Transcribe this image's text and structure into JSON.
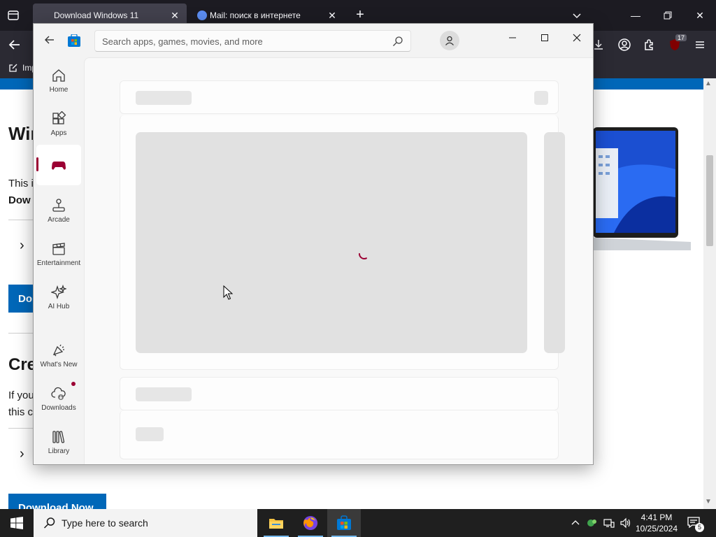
{
  "browser": {
    "tabs": [
      {
        "label": "Download Windows 11",
        "active": true
      },
      {
        "label": "Mail: поиск в интернете",
        "active": false
      }
    ],
    "bookmarks": [
      {
        "label": "Imp"
      }
    ],
    "extension_badge": "17",
    "accent": "#1c1b22"
  },
  "webpage": {
    "title": "Win",
    "text1": "This i",
    "text2": "Dow",
    "button1": "Do",
    "title2": "Cre",
    "text3_line1": "If you",
    "text3_line2": "this c",
    "button2": "Download Now",
    "brand_color": "#0067b8"
  },
  "store": {
    "search_placeholder": "Search apps, games, movies, and more",
    "nav": [
      {
        "id": "home",
        "label": "Home",
        "icon": "home-icon"
      },
      {
        "id": "apps",
        "label": "Apps",
        "icon": "apps-icon"
      },
      {
        "id": "gaming",
        "label": "",
        "icon": "gamepad-icon",
        "selected": true
      },
      {
        "id": "arcade",
        "label": "Arcade",
        "icon": "joystick-icon"
      },
      {
        "id": "entertainment",
        "label": "Entertainment",
        "icon": "clapperboard-icon"
      },
      {
        "id": "ai-hub",
        "label": "AI Hub",
        "icon": "sparkle-icon"
      },
      {
        "id": "whats-new",
        "label": "What's New",
        "icon": "megaphone-icon"
      },
      {
        "id": "downloads",
        "label": "Downloads",
        "icon": "cloud-download-icon",
        "has_badge": true
      },
      {
        "id": "library",
        "label": "Library",
        "icon": "library-icon"
      }
    ],
    "accent": "#9b0033",
    "loading": true
  },
  "taskbar": {
    "search_placeholder": "Type here to search",
    "time": "4:41 PM",
    "date": "10/25/2024",
    "notification_count": "5"
  }
}
